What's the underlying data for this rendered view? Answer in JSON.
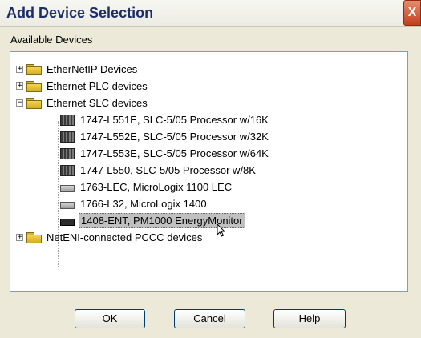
{
  "window": {
    "title": "Add Device Selection",
    "close_glyph": "X"
  },
  "section_label": "Available Devices",
  "tree": {
    "categories": [
      {
        "label": "EtherNetIP Devices",
        "expander": "+"
      },
      {
        "label": "Ethernet PLC devices",
        "expander": "+"
      },
      {
        "label": "Ethernet SLC devices",
        "expander": "−"
      },
      {
        "label": "NetENI-connected PCCC devices",
        "expander": "+"
      }
    ],
    "devices": [
      {
        "label": "1747-L551E, SLC-5/05 Processor w/16K",
        "icon": "processor-icon"
      },
      {
        "label": "1747-L552E, SLC-5/05 Processor w/32K",
        "icon": "processor-icon"
      },
      {
        "label": "1747-L553E, SLC-5/05 Processor w/64K",
        "icon": "processor-icon"
      },
      {
        "label": "1747-L550, SLC-5/05 Processor w/8K",
        "icon": "processor-icon"
      },
      {
        "label": "1763-LEC, MicroLogix 1100 LEC",
        "icon": "module-icon"
      },
      {
        "label": "1766-L32, MicroLogix 1400",
        "icon": "module-icon"
      },
      {
        "label": "1408-ENT, PM1000 EnergyMonitor",
        "icon": "energy-monitor-icon",
        "selected": true
      }
    ]
  },
  "buttons": {
    "ok": "OK",
    "cancel": "Cancel",
    "help": "Help"
  }
}
